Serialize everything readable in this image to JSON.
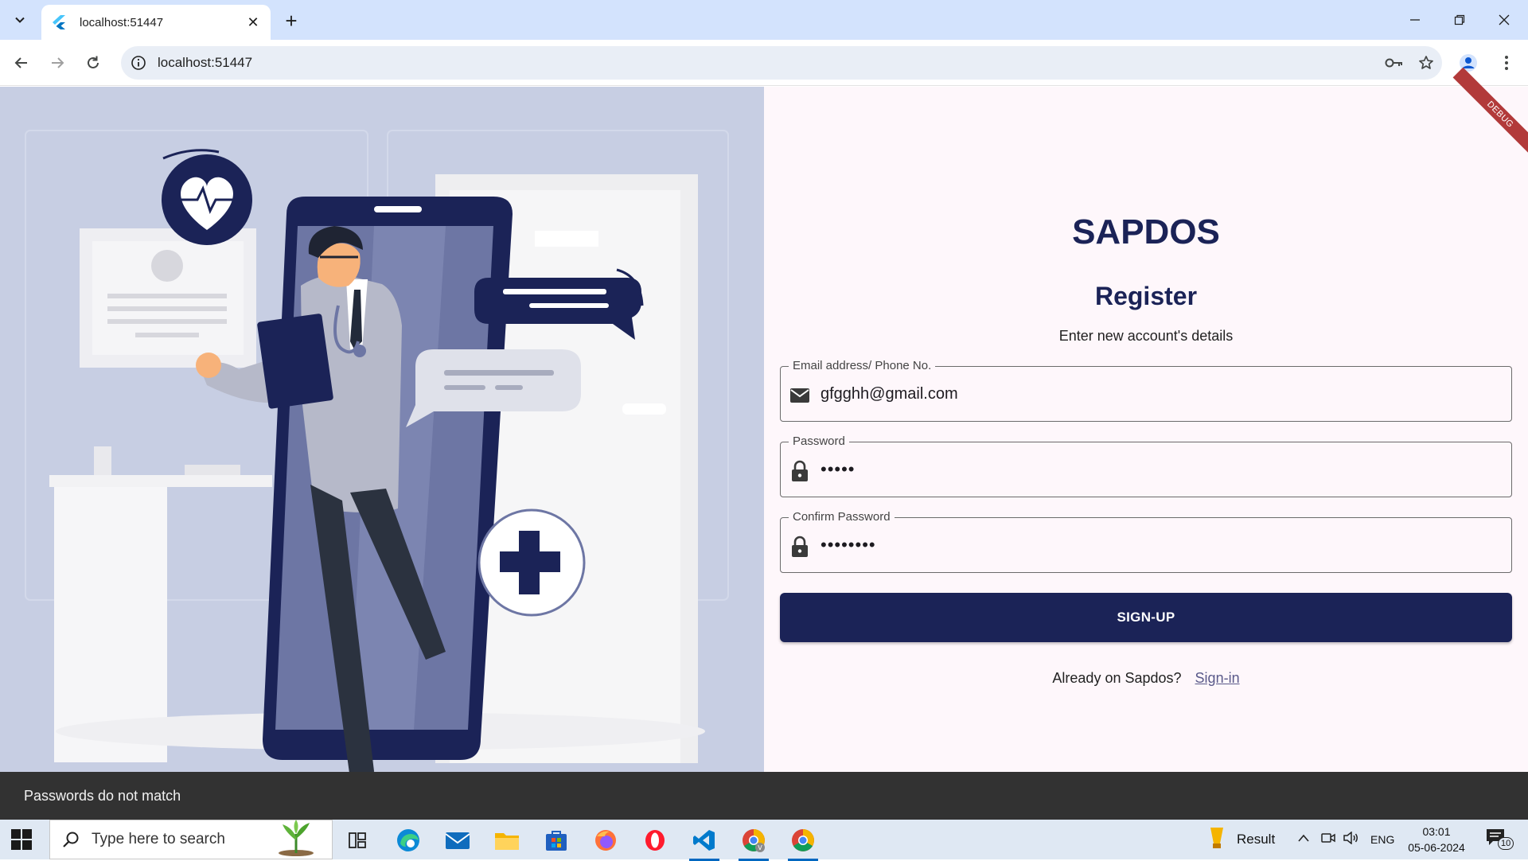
{
  "browser": {
    "tab_title": "localhost:51447",
    "url": "localhost:51447"
  },
  "app": {
    "debug_banner": "DEBUG",
    "title": "SAPDOS",
    "form_title": "Register",
    "subtitle": "Enter new account's details",
    "fields": [
      {
        "label": "Email address/ Phone No.",
        "value": "gfgghh@gmail.com",
        "icon": "mail-icon"
      },
      {
        "label": "Password",
        "value": "•••••",
        "icon": "lock-icon"
      },
      {
        "label": "Confirm Password",
        "value": "••••••••",
        "icon": "lock-icon"
      }
    ],
    "signup_label": "SIGN-UP",
    "already_text": "Already on Sapdos?",
    "signin_label": "Sign-in",
    "snackbar": "Passwords do not match"
  },
  "taskbar": {
    "search_placeholder": "Type here to search",
    "weather_label": "Result",
    "language": "ENG",
    "time": "03:01",
    "date": "05-06-2024",
    "notification_count": "10"
  },
  "colors": {
    "brand_navy": "#1b2357",
    "illustration_bg": "#c7cee3",
    "chrome_tabbar": "#d3e3fd",
    "debug_red": "#b23a3a"
  }
}
